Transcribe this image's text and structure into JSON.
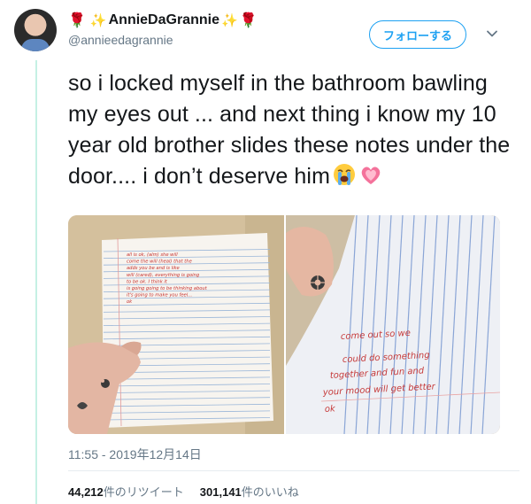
{
  "author": {
    "display_name": "AnnieDaGrannie",
    "handle": "@annieedagrannie",
    "avatar_icon": "profile-avatar",
    "name_emojis": [
      "rose",
      "sparkles",
      "sparkles",
      "rose"
    ]
  },
  "actions": {
    "follow_label": "フォローする",
    "menu_icon": "chevron-down-icon"
  },
  "tweet": {
    "text": "so i locked myself in the bathroom bawling my eyes out ... and next thing i know my 10 year old brother slides these notes under the door.... i don’t deserve him",
    "trailing_emojis": [
      "loudly-crying-face",
      "growing-heart"
    ]
  },
  "media": {
    "photos": [
      {
        "description_icon": "handwritten-note-photo",
        "note_lines": [
          "all is ok, (alm) she will",
          "come the will (heal) that the",
          "adds you be and is like",
          "will (cared), everything is going",
          "to be ok. I think it",
          "is going going to be thinking about",
          "it's going to make you feel...",
          "ok"
        ]
      },
      {
        "description_icon": "handwritten-note-photo",
        "note_lines": [
          "come out    so we",
          "could do something",
          "together and fun and",
          "your mood will get better",
          "ok"
        ]
      }
    ]
  },
  "meta": {
    "timestamp": "11:55 - 2019年12月14日"
  },
  "stats": {
    "retweets_count": "44,212",
    "retweets_label": "件のリツイート",
    "likes_count": "301,141",
    "likes_label": "件のいいね"
  },
  "colors": {
    "accent": "#1da1f2",
    "thread_line": "#c5f0e4",
    "secondary_text": "#657786",
    "ink": "#c8322f"
  }
}
